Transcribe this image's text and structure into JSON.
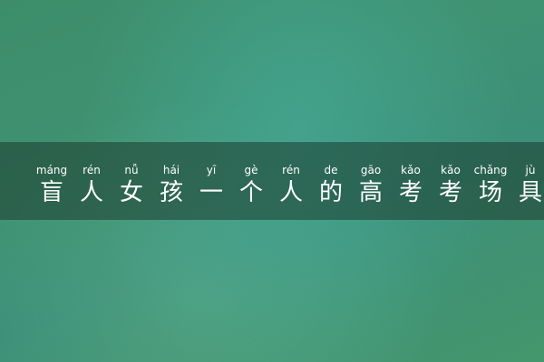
{
  "title": {
    "pinyin": [
      "máng",
      "rén",
      "nǚ",
      "hái",
      "yī",
      "gè",
      "rén",
      "de",
      "gāo",
      "kǎo",
      "kǎo",
      "chǎng",
      "jù"
    ],
    "chars": [
      "盲",
      "人",
      "女",
      "孩",
      "一",
      "个",
      "人",
      "的",
      "高",
      "考",
      "考",
      "场",
      "具"
    ]
  },
  "colors": {
    "background": "#3f9272",
    "band": "#1c3a2e",
    "text": "#ffffff"
  }
}
